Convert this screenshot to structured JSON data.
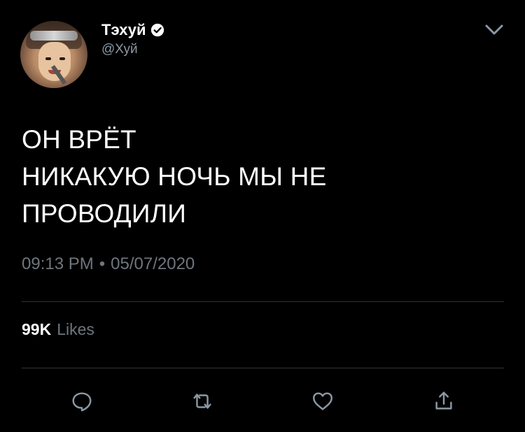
{
  "colors": {
    "background": "#000000",
    "text_primary": "#ffffff",
    "text_secondary": "#6e767d",
    "handle": "#8b98a5",
    "divider": "#2f3336",
    "icon": "#8b98a5"
  },
  "author": {
    "display_name": "Тэхуй",
    "handle": "@Хуй",
    "verified_icon": "verified-badge-icon",
    "avatar": "profile-photo"
  },
  "menu_icon": "chevron-down-icon",
  "tweet": {
    "lines": [
      "ОН ВРЁТ",
      "НИКАКУЮ НОЧЬ МЫ НЕ",
      "ПРОВОДИЛИ"
    ],
    "time": "09:13 PM",
    "separator": "•",
    "date": "05/07/2020"
  },
  "stats": {
    "likes_count": "99K",
    "likes_label": "Likes"
  },
  "actions": [
    {
      "icon": "reply-icon"
    },
    {
      "icon": "retweet-icon"
    },
    {
      "icon": "like-icon"
    },
    {
      "icon": "share-icon"
    }
  ]
}
